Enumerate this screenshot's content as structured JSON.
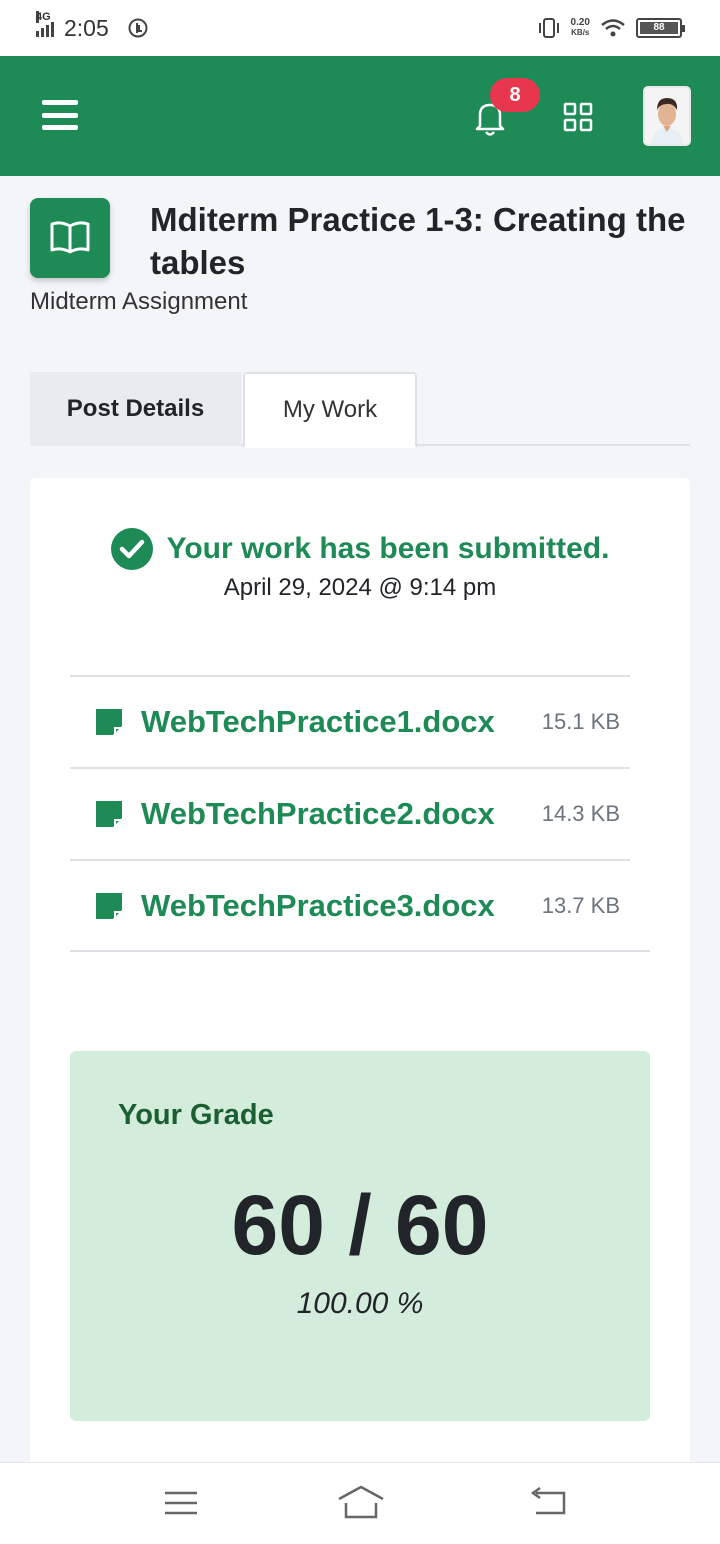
{
  "status_bar": {
    "network": "4G",
    "time": "2:05",
    "speed_value": "0.20",
    "speed_unit": "KB/s",
    "battery": "88"
  },
  "app_bar": {
    "notification_count": "8"
  },
  "post": {
    "title": "Mditerm Practice 1-3: Creating the tables",
    "subtitle": "Midterm Assignment"
  },
  "tabs": [
    {
      "label": "Post Details",
      "active": false
    },
    {
      "label": "My Work",
      "active": true
    }
  ],
  "submission": {
    "status": "Your work has been submitted.",
    "date": "April 29, 2024 @ 9:14 pm"
  },
  "files": [
    {
      "name": "WebTechPractice1.docx",
      "size": "15.1 KB"
    },
    {
      "name": "WebTechPractice2.docx",
      "size": "14.3 KB"
    },
    {
      "name": "WebTechPractice3.docx",
      "size": "13.7 KB"
    }
  ],
  "grade": {
    "label": "Your Grade",
    "score": "60 / 60",
    "percent": "100.00 %"
  },
  "colors": {
    "brand_green": "#1e8a55",
    "badge_red": "#e8364f",
    "grade_bg": "#d4ecdc"
  },
  "icons": [
    "signal-icon",
    "alarm-icon",
    "vibrate-icon",
    "wifi-icon",
    "battery-icon",
    "menu-icon",
    "bell-icon",
    "grid-icon",
    "book-icon",
    "check-circle-icon",
    "document-icon",
    "nav-menu-icon",
    "nav-home-icon",
    "nav-back-icon"
  ]
}
